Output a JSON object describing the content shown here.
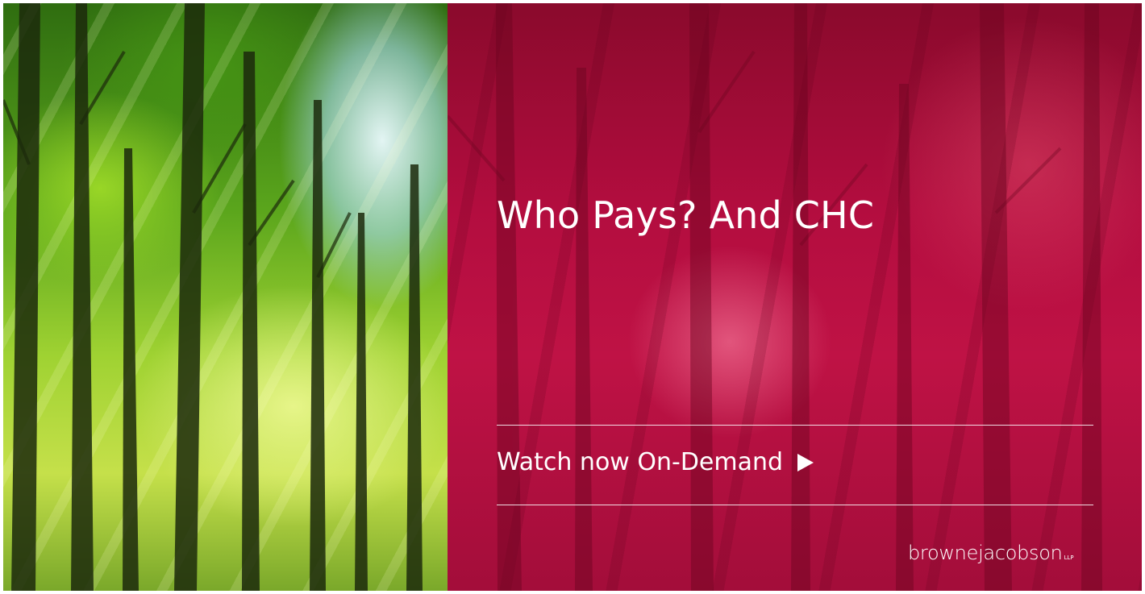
{
  "banner": {
    "title": "Who Pays? And CHC",
    "cta": {
      "label": "Watch now On-Demand",
      "icon": "play-icon"
    },
    "logo": {
      "wordmark": "brownejacobson",
      "suffix": "LLP"
    }
  },
  "colors": {
    "panel": "#b30d3f",
    "text": "#ffffff",
    "forest": "#5aa51c"
  }
}
